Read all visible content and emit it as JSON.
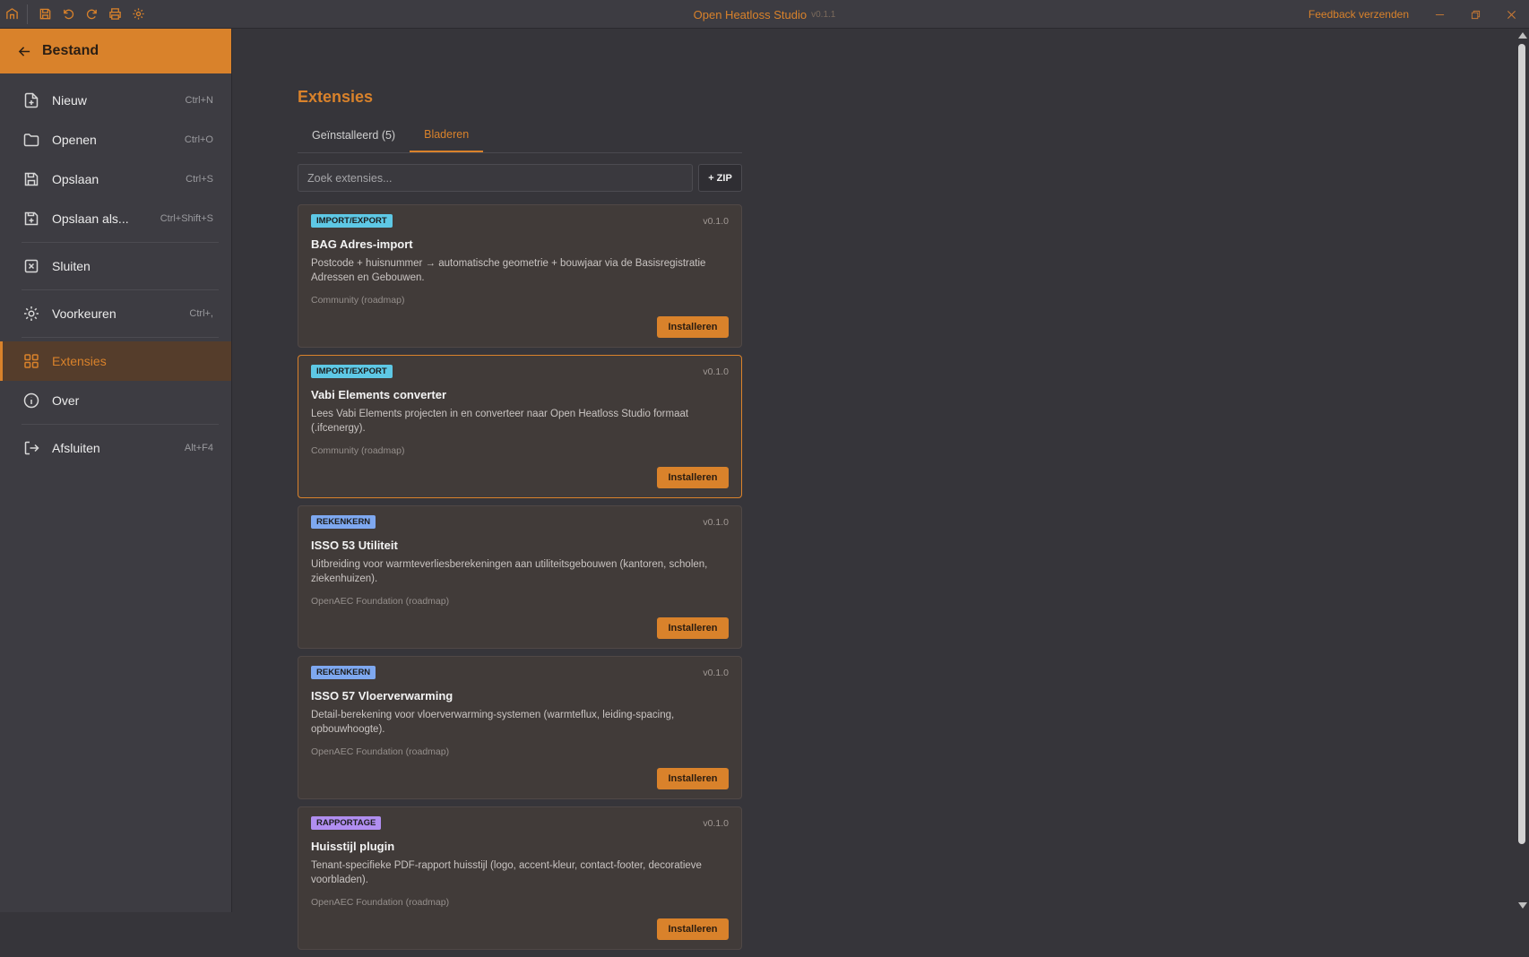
{
  "titlebar": {
    "app_name": "Open Heatloss Studio",
    "version": "v0.1.1",
    "feedback_label": "Feedback verzenden"
  },
  "sidebar": {
    "header": "Bestand",
    "items": [
      {
        "label": "Nieuw",
        "shortcut": "Ctrl+N",
        "icon": "file-plus-icon"
      },
      {
        "label": "Openen",
        "shortcut": "Ctrl+O",
        "icon": "folder-icon"
      },
      {
        "label": "Opslaan",
        "shortcut": "Ctrl+S",
        "icon": "save-icon"
      },
      {
        "label": "Opslaan als...",
        "shortcut": "Ctrl+Shift+S",
        "icon": "save-as-icon"
      },
      {
        "label": "Sluiten",
        "shortcut": "",
        "icon": "close-square-icon"
      },
      {
        "label": "Voorkeuren",
        "shortcut": "Ctrl+,",
        "icon": "gear-icon"
      },
      {
        "label": "Extensies",
        "shortcut": "",
        "icon": "grid-icon"
      },
      {
        "label": "Over",
        "shortcut": "",
        "icon": "info-icon"
      },
      {
        "label": "Afsluiten",
        "shortcut": "Alt+F4",
        "icon": "logout-icon"
      }
    ]
  },
  "main": {
    "title": "Extensies",
    "tabs": [
      {
        "label": "Geïnstalleerd (5)",
        "active": false
      },
      {
        "label": "Bladeren",
        "active": true
      }
    ],
    "search_placeholder": "Zoek extensies...",
    "zip_label": "+ ZIP",
    "install_label": "Installeren",
    "extensions": [
      {
        "badge": "IMPORT/EXPORT",
        "badge_color": "#5ec8e5",
        "version": "v0.1.0",
        "title": "BAG Adres-import",
        "description": "Postcode + huisnummer → automatische geometrie + bouwjaar via de Basisregistratie Adressen en Gebouwen.",
        "author": "Community (roadmap)"
      },
      {
        "badge": "IMPORT/EXPORT",
        "badge_color": "#5ec8e5",
        "version": "v0.1.0",
        "title": "Vabi Elements converter",
        "description": "Lees Vabi Elements projecten in en converteer naar Open Heatloss Studio formaat (.ifcenergy).",
        "author": "Community (roadmap)"
      },
      {
        "badge": "REKENKERN",
        "badge_color": "#7ea8f0",
        "version": "v0.1.0",
        "title": "ISSO 53 Utiliteit",
        "description": "Uitbreiding voor warmteverliesberekeningen aan utiliteitsgebouwen (kantoren, scholen, ziekenhuizen).",
        "author": "OpenAEC Foundation (roadmap)"
      },
      {
        "badge": "REKENKERN",
        "badge_color": "#7ea8f0",
        "version": "v0.1.0",
        "title": "ISSO 57 Vloerverwarming",
        "description": "Detail-berekening voor vloerverwarming-systemen (warmteflux, leiding-spacing, opbouwhoogte).",
        "author": "OpenAEC Foundation (roadmap)"
      },
      {
        "badge": "RAPPORTAGE",
        "badge_color": "#b08ef0",
        "version": "v0.1.0",
        "title": "Huisstijl plugin",
        "description": "Tenant-specifieke PDF-rapport huisstijl (logo, accent-kleur, contact-footer, decoratieve voorbladen).",
        "author": "OpenAEC Foundation (roadmap)"
      }
    ]
  },
  "colors": {
    "accent": "#d9822b",
    "background": "#36353a",
    "sidebar": "#3d3c42",
    "card": "#413b39"
  }
}
